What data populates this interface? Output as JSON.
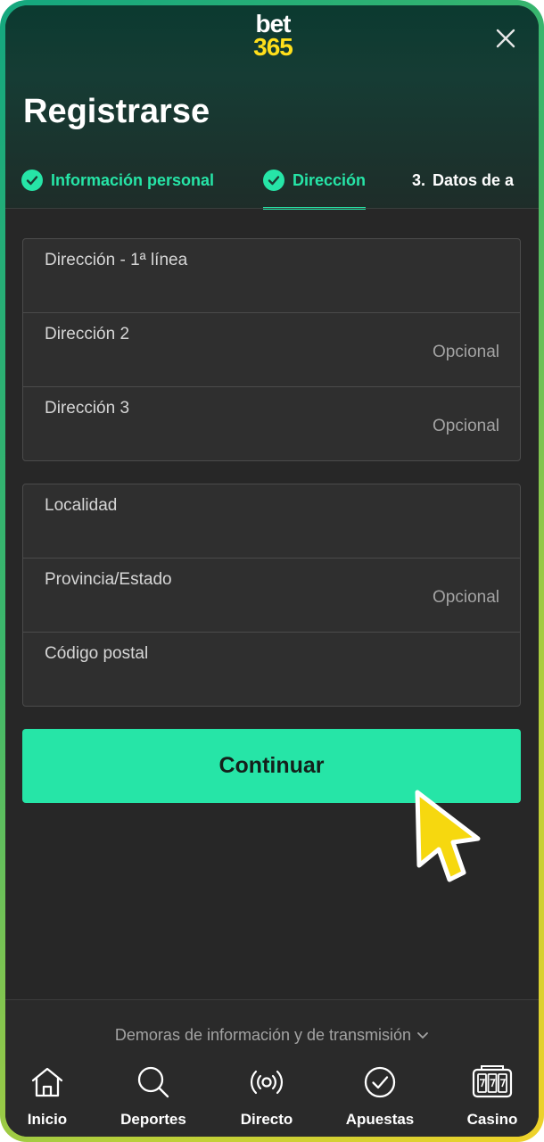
{
  "header": {
    "logo_top": "bet",
    "logo_bottom": "365",
    "title": "Registrarse"
  },
  "steps": [
    {
      "label": "Información personal",
      "state": "done"
    },
    {
      "label": "Dirección",
      "state": "active"
    },
    {
      "number": "3.",
      "label": "Datos de a",
      "state": "pending"
    }
  ],
  "address_group": [
    {
      "label": "Dirección - 1ª línea",
      "optional": ""
    },
    {
      "label": "Dirección 2",
      "optional": "Opcional"
    },
    {
      "label": "Dirección 3",
      "optional": "Opcional"
    }
  ],
  "location_group": [
    {
      "label": "Localidad",
      "optional": ""
    },
    {
      "label": "Provincia/Estado",
      "optional": "Opcional"
    },
    {
      "label": "Código postal",
      "optional": ""
    }
  ],
  "continue_label": "Continuar",
  "footer": {
    "delays_text": "Demoras de información y de transmisión"
  },
  "nav": [
    {
      "label": "Inicio",
      "icon": "home-icon"
    },
    {
      "label": "Deportes",
      "icon": "search-icon"
    },
    {
      "label": "Directo",
      "icon": "live-broadcast-icon"
    },
    {
      "label": "Apuestas",
      "icon": "check-circle-icon"
    },
    {
      "label": "Casino",
      "icon": "slot-machine-icon"
    }
  ],
  "colors": {
    "accent": "#26e5a7",
    "logo_yellow": "#ffdf1b",
    "background": "#272727",
    "header_dark_green": "#0b3a30"
  }
}
